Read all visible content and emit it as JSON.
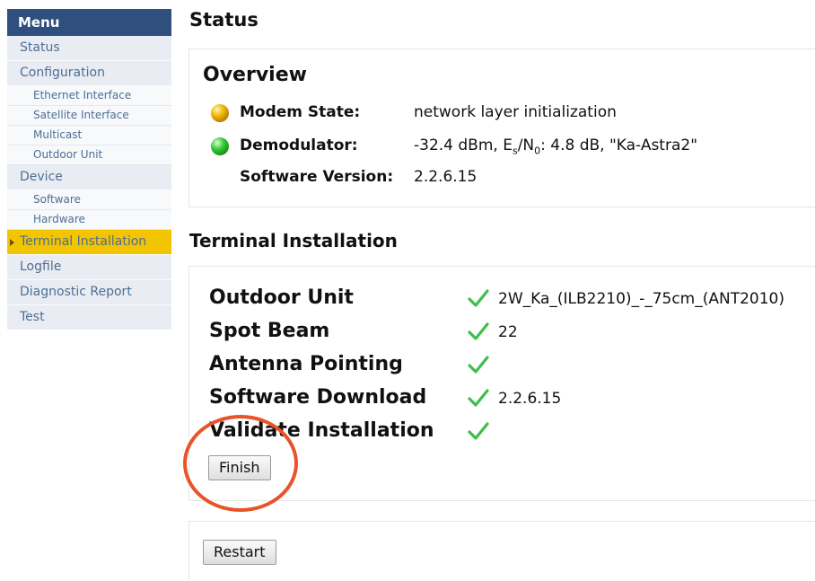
{
  "sidebar": {
    "header": "Menu",
    "items": {
      "status": "Status",
      "configuration": "Configuration",
      "ethernet_interface": "Ethernet Interface",
      "satellite_interface": "Satellite Interface",
      "multicast": "Multicast",
      "outdoor_unit": "Outdoor Unit",
      "device": "Device",
      "software": "Software",
      "hardware": "Hardware",
      "terminal_installation": "Terminal Installation",
      "logfile": "Logfile",
      "diagnostic_report": "Diagnostic Report",
      "test": "Test"
    },
    "active_item": "Terminal Installation"
  },
  "page": {
    "title": "Status"
  },
  "overview": {
    "heading": "Overview",
    "modem_state": {
      "label": "Modem State:",
      "value": "network layer initialization",
      "indicator": "amber"
    },
    "demodulator": {
      "label": "Demodulator:",
      "value_prefix": "-32.4 dBm, E",
      "sub_s": "s",
      "slash_n": "/N",
      "sub_0": "0",
      "value_suffix": ": 4.8 dB, \"Ka-Astra2\"",
      "indicator": "green"
    },
    "software_version": {
      "label": "Software Version:",
      "value": "2.2.6.15"
    }
  },
  "terminal_installation": {
    "title": "Terminal Installation",
    "rows": [
      {
        "label": "Outdoor Unit",
        "status": "check",
        "value": "2W_Ka_(ILB2210)_-_75cm_(ANT2010)"
      },
      {
        "label": "Spot Beam",
        "status": "check",
        "value": "22"
      },
      {
        "label": "Antenna Pointing",
        "status": "check",
        "value": ""
      },
      {
        "label": "Software Download",
        "status": "check",
        "value": "2.2.6.15"
      },
      {
        "label": "Validate Installation",
        "status": "check",
        "value": ""
      }
    ],
    "finish_label": "Finish"
  },
  "restart_label": "Restart",
  "colors": {
    "menu_header": "#2f507e",
    "active_item": "#f3c400",
    "check": "#3cbf4a",
    "highlight_ring": "#e8542a"
  }
}
